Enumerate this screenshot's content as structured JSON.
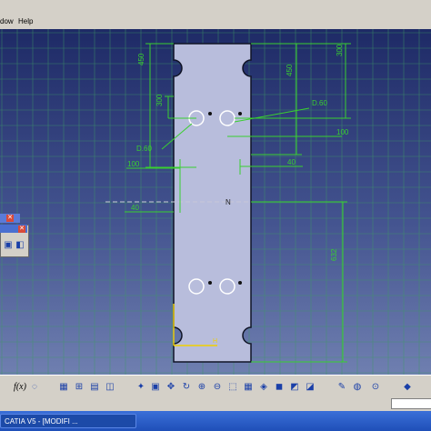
{
  "menu": {
    "items": [
      "dow",
      "Help"
    ]
  },
  "drawing": {
    "dimensions": {
      "d450_left": "450",
      "d300_top": "300",
      "d450_right": "450",
      "d300_left": "300",
      "d60_right": "D.60",
      "d60_left": "D.60",
      "d100_right": "100",
      "d100_left": "100",
      "d40_right": "40",
      "d40_left": "40",
      "d632": "632"
    }
  },
  "toolbar": {
    "fx_label": "f(x)"
  },
  "taskbar": {
    "item_label": "CATIA V5 - [MODIFI ..."
  },
  "colors": {
    "grid": "#3e9a66",
    "part_fill": "#b8bddc",
    "dimension": "#39d02f",
    "selection": "#ffffff"
  }
}
